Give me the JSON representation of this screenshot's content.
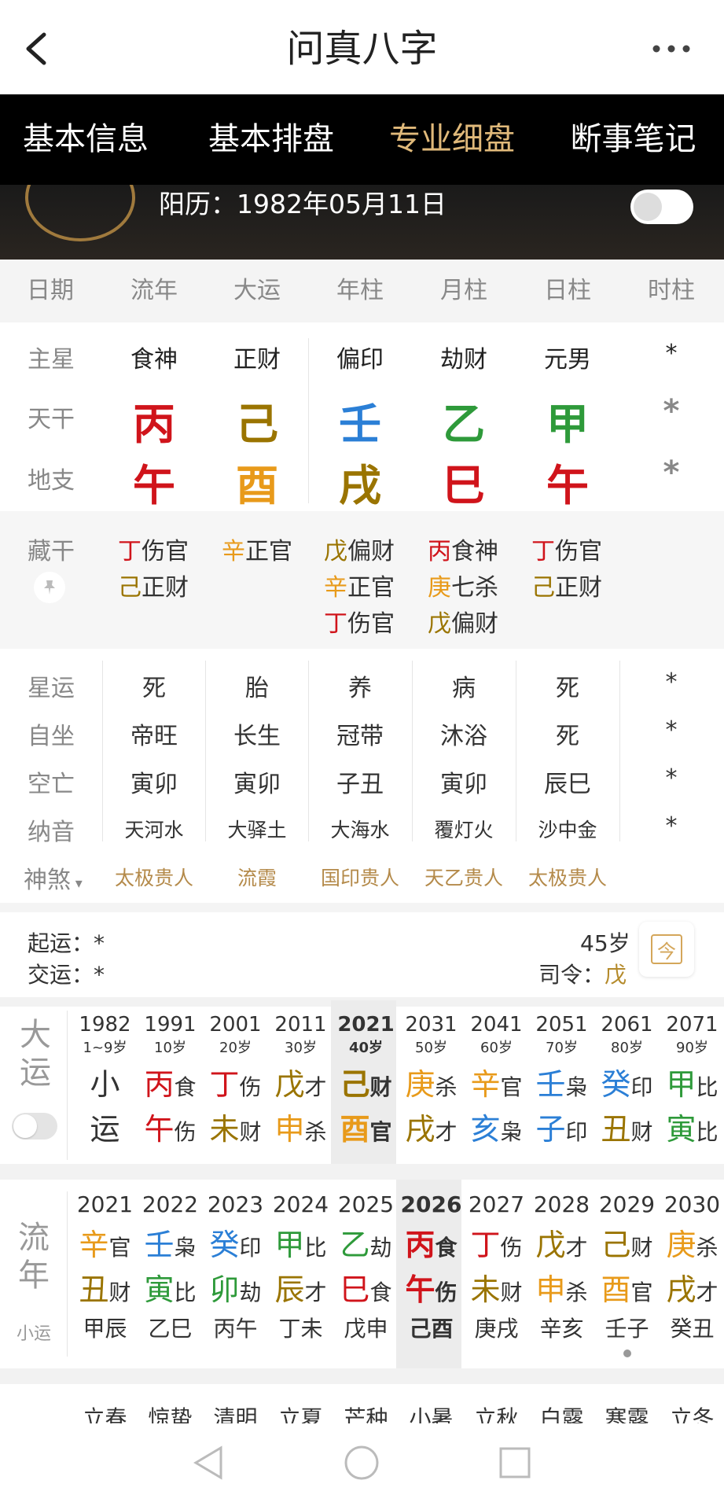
{
  "app": {
    "title": "问真八字"
  },
  "tabs": [
    {
      "label": "基本信息"
    },
    {
      "label": "基本排盘"
    },
    {
      "label": "专业细盘"
    },
    {
      "label": "断事笔记"
    }
  ],
  "hero": {
    "solar_label": "阳历：1982年05月11日"
  },
  "columns": [
    "日期",
    "流年",
    "大运",
    "年柱",
    "月柱",
    "日柱",
    "时柱"
  ],
  "rows": {
    "zhuxing": {
      "label": "主星",
      "values": [
        "食神",
        "正财",
        "偏印",
        "劫财",
        "元男",
        "*"
      ]
    },
    "tiangan": {
      "label": "天干",
      "values": [
        "丙",
        "己",
        "壬",
        "乙",
        "甲",
        "*"
      ]
    },
    "dizhi": {
      "label": "地支",
      "values": [
        "午",
        "酉",
        "戌",
        "巳",
        "午",
        "*"
      ]
    }
  },
  "canggan": {
    "label": "藏干",
    "cols": [
      [
        {
          "g": "丁",
          "s": "伤官"
        },
        {
          "g": "己",
          "s": "正财"
        }
      ],
      [
        {
          "g": "辛",
          "s": "正官"
        }
      ],
      [
        {
          "g": "戊",
          "s": "偏财"
        },
        {
          "g": "辛",
          "s": "正官"
        },
        {
          "g": "丁",
          "s": "伤官"
        }
      ],
      [
        {
          "g": "丙",
          "s": "食神"
        },
        {
          "g": "庚",
          "s": "七杀"
        },
        {
          "g": "戊",
          "s": "偏财"
        }
      ],
      [
        {
          "g": "丁",
          "s": "伤官"
        },
        {
          "g": "己",
          "s": "正财"
        }
      ]
    ]
  },
  "info_rows": {
    "xingyun": {
      "label": "星运",
      "values": [
        "死",
        "胎",
        "养",
        "病",
        "死",
        "*"
      ]
    },
    "zizuo": {
      "label": "自坐",
      "values": [
        "帝旺",
        "长生",
        "冠带",
        "沐浴",
        "死",
        "*"
      ]
    },
    "kongwang": {
      "label": "空亡",
      "values": [
        "寅卯",
        "寅卯",
        "子丑",
        "寅卯",
        "辰巳",
        "*"
      ]
    },
    "nayin": {
      "label": "纳音",
      "values": [
        "天河水",
        "大驿土",
        "大海水",
        "覆灯火",
        "沙中金",
        "*"
      ]
    },
    "shensha": {
      "label": "神煞",
      "values": [
        "太极贵人",
        "流霞",
        "国印贵人",
        "天乙贵人",
        "太极贵人"
      ]
    }
  },
  "qiyun": {
    "start_label": "起运：",
    "start_value": "*",
    "jiao_label": "交运：",
    "jiao_value": "*",
    "age": "45岁",
    "siling_label": "司令：",
    "siling_value": "戊",
    "cal_icon_text": "今"
  },
  "dayun": {
    "label": [
      "大",
      "运"
    ],
    "cols": [
      {
        "year": "1982",
        "age": "1~9岁",
        "g": "小",
        "gs": "",
        "z": "运",
        "zs": ""
      },
      {
        "year": "1991",
        "age": "10岁",
        "g": "丙",
        "gs": "食",
        "z": "午",
        "zs": "伤"
      },
      {
        "year": "2001",
        "age": "20岁",
        "g": "丁",
        "gs": "伤",
        "z": "未",
        "zs": "财"
      },
      {
        "year": "2011",
        "age": "30岁",
        "g": "戊",
        "gs": "才",
        "z": "申",
        "zs": "杀"
      },
      {
        "year": "2021",
        "age": "40岁",
        "g": "己",
        "gs": "财",
        "z": "酉",
        "zs": "官"
      },
      {
        "year": "2031",
        "age": "50岁",
        "g": "庚",
        "gs": "杀",
        "z": "戌",
        "zs": "才"
      },
      {
        "year": "2041",
        "age": "60岁",
        "g": "辛",
        "gs": "官",
        "z": "亥",
        "zs": "枭"
      },
      {
        "year": "2051",
        "age": "70岁",
        "g": "壬",
        "gs": "枭",
        "z": "子",
        "zs": "印"
      },
      {
        "year": "2061",
        "age": "80岁",
        "g": "癸",
        "gs": "印",
        "z": "丑",
        "zs": "财"
      },
      {
        "year": "2071",
        "age": "90岁",
        "g": "甲",
        "gs": "比",
        "z": "寅",
        "zs": "比"
      }
    ]
  },
  "liunian": {
    "label": [
      "流",
      "年"
    ],
    "sub_label": "小运",
    "cols": [
      {
        "year": "2021",
        "g": "辛",
        "gs": "官",
        "z": "丑",
        "zs": "财",
        "xy": "甲辰"
      },
      {
        "year": "2022",
        "g": "壬",
        "gs": "枭",
        "z": "寅",
        "zs": "比",
        "xy": "乙巳"
      },
      {
        "year": "2023",
        "g": "癸",
        "gs": "印",
        "z": "卯",
        "zs": "劫",
        "xy": "丙午"
      },
      {
        "year": "2024",
        "g": "甲",
        "gs": "比",
        "z": "辰",
        "zs": "才",
        "xy": "丁未"
      },
      {
        "year": "2025",
        "g": "乙",
        "gs": "劫",
        "z": "巳",
        "zs": "食",
        "xy": "戊申"
      },
      {
        "year": "2026",
        "g": "丙",
        "gs": "食",
        "z": "午",
        "zs": "伤",
        "xy": "己酉"
      },
      {
        "year": "2027",
        "g": "丁",
        "gs": "伤",
        "z": "未",
        "zs": "财",
        "xy": "庚戌"
      },
      {
        "year": "2028",
        "g": "戊",
        "gs": "才",
        "z": "申",
        "zs": "杀",
        "xy": "辛亥"
      },
      {
        "year": "2029",
        "g": "己",
        "gs": "财",
        "z": "酉",
        "zs": "官",
        "xy": "壬子"
      },
      {
        "year": "2030",
        "g": "庚",
        "gs": "杀",
        "z": "戌",
        "zs": "才",
        "xy": "癸丑"
      }
    ]
  },
  "jieqi": [
    "立春",
    "惊蛰",
    "清明",
    "立夏",
    "芒种",
    "小暑",
    "立秋",
    "白露",
    "寒露",
    "立冬"
  ],
  "colors": {
    "fire": "#d0141b",
    "earth": "#9a7400",
    "water": "#2b7fd6",
    "wood": "#2e9a3a",
    "metal": "#e89a1a",
    "gold_accent": "#e0b97a"
  }
}
